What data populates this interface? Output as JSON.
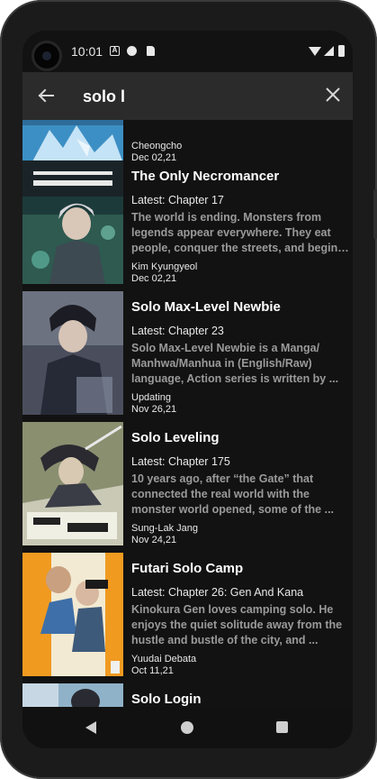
{
  "status_bar": {
    "time": "10:01",
    "icons": [
      "a-badge-icon",
      "pie-icon",
      "sd-card-icon",
      "wifi-icon",
      "signal-icon",
      "battery-icon"
    ]
  },
  "search": {
    "query": "solo l",
    "back_icon": "arrow-left-icon",
    "clear_icon": "close-icon"
  },
  "results": [
    {
      "title": "",
      "latest": "",
      "description": "",
      "author": "Cheongcho",
      "date": "Dec 02,21"
    },
    {
      "title": "The Only Necromancer",
      "latest": "Latest: Chapter 17",
      "description": "The world is ending. Monsters from legends appear everywhere. They eat people, conquer the streets, and begin to take over...",
      "author": "Kim Kyungyeol",
      "date": "Dec 02,21"
    },
    {
      "title": "Solo Max-Level Newbie",
      "latest": "Latest: Chapter 23",
      "description": "Solo Max-Level Newbie is a Manga/ Manhwa/Manhua in (English/Raw) language, Action series is written by ...",
      "author": "Updating",
      "date": "Nov 26,21"
    },
    {
      "title": "Solo Leveling",
      "latest": "Latest: Chapter 175",
      "description": "10 years ago, after “the Gate” that connected the real world with the monster world opened, some of the ...",
      "author": "Sung-Lak Jang",
      "date": "Nov 24,21"
    },
    {
      "title": "Futari Solo Camp",
      "latest": "Latest: Chapter 26: Gen And Kana",
      "description": "Kinokura Gen loves camping solo. He enjoys the quiet solitude away from the hustle and bustle of the city, and ...",
      "author": "Yuudai Debata",
      "date": "Oct 11,21"
    },
    {
      "title": "Solo Login",
      "latest": "",
      "description": "",
      "author": "",
      "date": ""
    }
  ],
  "colors": {
    "background": "#121212",
    "search_bar": "#2b2b2b",
    "title_text": "#ffffff",
    "description_text": "#9a9a9a"
  },
  "nav_bar": {
    "icons": [
      "nav-back-icon",
      "nav-home-icon",
      "nav-recents-icon"
    ]
  }
}
